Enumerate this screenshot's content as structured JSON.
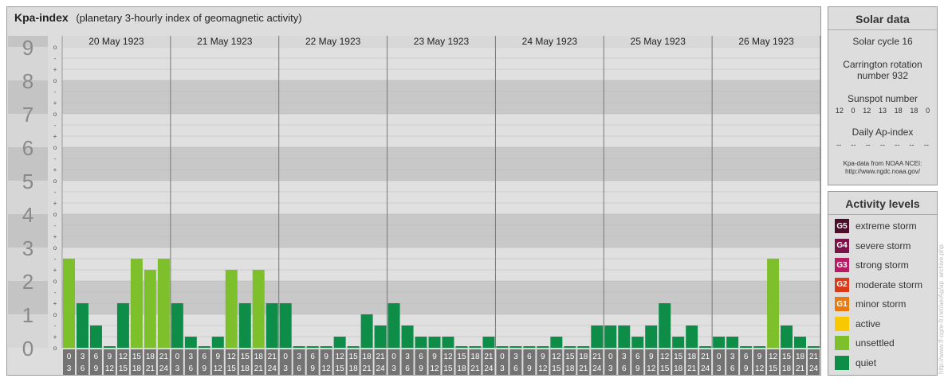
{
  "header": {
    "title": "Kpa-index",
    "subtitle": "(planetary 3-hourly index of geomagnetic activity)"
  },
  "chart_data": {
    "type": "bar",
    "ylim": [
      0,
      9
    ],
    "y_ticks": [
      "0",
      "1",
      "2",
      "3",
      "4",
      "5",
      "6",
      "7",
      "8",
      "9"
    ],
    "minor_ticks": [
      "o",
      "+",
      "-"
    ],
    "days": [
      "20 May 1923",
      "21 May 1923",
      "22 May 1923",
      "23 May 1923",
      "24 May 1923",
      "25 May 1923",
      "26 May 1923"
    ],
    "interval_starts": [
      "0",
      "3",
      "6",
      "9",
      "12",
      "15",
      "18",
      "21"
    ],
    "interval_ends": [
      "3",
      "6",
      "9",
      "12",
      "15",
      "18",
      "21",
      "24"
    ],
    "values": [
      [
        2.667,
        1.333,
        0.667,
        0,
        1.333,
        2.667,
        2.333,
        2.667
      ],
      [
        1.333,
        0.333,
        0,
        0.333,
        2.333,
        1.333,
        2.333,
        1.333
      ],
      [
        1.333,
        0,
        0,
        0,
        0.333,
        0,
        1,
        0.667
      ],
      [
        1.333,
        0.667,
        0.333,
        0.333,
        0.333,
        0,
        0,
        0.333
      ],
      [
        0,
        0,
        0,
        0,
        0.333,
        0,
        0,
        0.667
      ],
      [
        0.667,
        0.667,
        0.333,
        0.667,
        1.333,
        0.333,
        0.667,
        0
      ],
      [
        0.333,
        0.333,
        0,
        0,
        2.667,
        0.667,
        0.333,
        0
      ]
    ],
    "colors": {
      "quiet": "#0e8d48",
      "unsettled": "#7dc02c"
    },
    "grid": true
  },
  "solar": {
    "title": "Solar data",
    "cycle": "Solar cycle 16",
    "carrington_line1": "Carrington rotation",
    "carrington_line2": "number 932",
    "sunspot_label": "Sunspot number",
    "sunspots": [
      "12",
      "0",
      "12",
      "13",
      "18",
      "18",
      "0"
    ],
    "ap_label": "Daily Ap-index",
    "ap": [
      "--",
      "--",
      "--",
      "--",
      "--",
      "--",
      "--"
    ],
    "source_line1": "Kpa-data from NOAA NCEI:",
    "source_line2": "http://www.ngdc.noaa.gov/"
  },
  "activity": {
    "title": "Activity levels",
    "levels": [
      {
        "code": "G5",
        "label": "extreme storm",
        "color": "#4a0e2a"
      },
      {
        "code": "G4",
        "label": "severe storm",
        "color": "#7a1448"
      },
      {
        "code": "G3",
        "label": "strong storm",
        "color": "#b81a63"
      },
      {
        "code": "G2",
        "label": "moderate storm",
        "color": "#d83a1a"
      },
      {
        "code": "G1",
        "label": "minor storm",
        "color": "#e87a10"
      },
      {
        "code": "",
        "label": "active",
        "color": "#f8c800"
      },
      {
        "code": "",
        "label": "unsettled",
        "color": "#7dc02c"
      },
      {
        "code": "",
        "label": "quiet",
        "color": "#0e8d48"
      }
    ]
  },
  "watermark": "http://www.tf-ogre-fr.net/ae/Ag/ap_archive.php"
}
